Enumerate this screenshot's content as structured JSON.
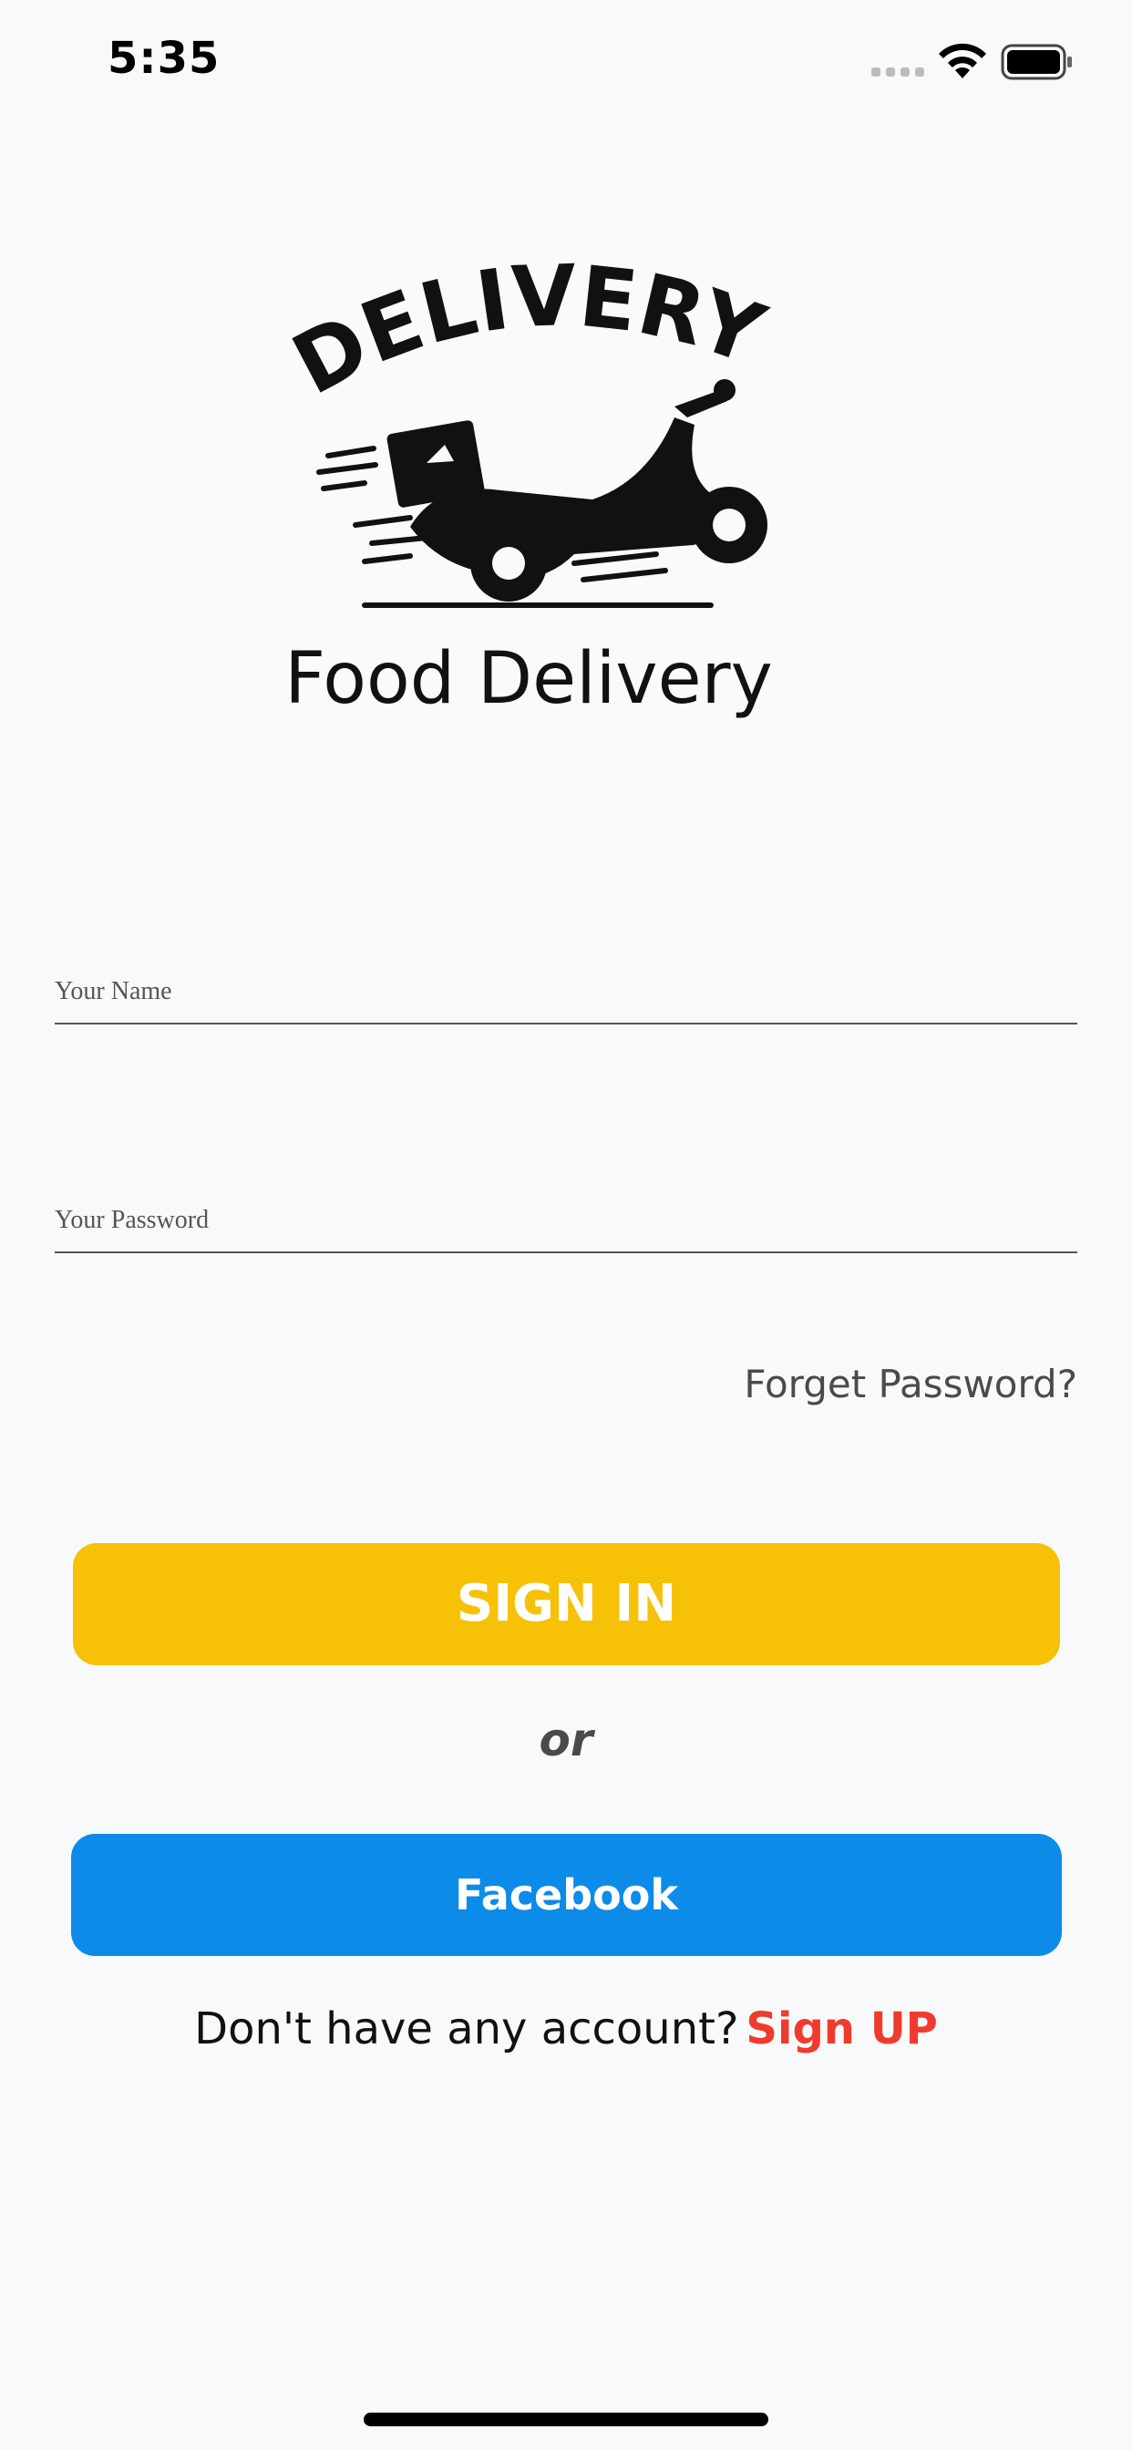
{
  "status_bar": {
    "time": "5:35",
    "icons": [
      "cellular-signal-icon",
      "wifi-icon",
      "battery-icon"
    ]
  },
  "logo": {
    "arc_text": "DELIVERY",
    "caption": "Food Delivery",
    "icon": "scooter-delivery-icon"
  },
  "form": {
    "name_placeholder": "Your Name",
    "name_value": "",
    "password_placeholder": "Your Password",
    "password_value": "",
    "forgot_label": "Forget Password?"
  },
  "actions": {
    "signin_label": "SIGN IN",
    "or_label": "or",
    "facebook_label": "Facebook"
  },
  "signup": {
    "prompt": "Don't have any account?",
    "link_label": "Sign UP"
  },
  "colors": {
    "background": "#f8f9fb",
    "signin": "#f6c106",
    "facebook": "#0d8be8",
    "signup_link": "#ee3b2e"
  }
}
